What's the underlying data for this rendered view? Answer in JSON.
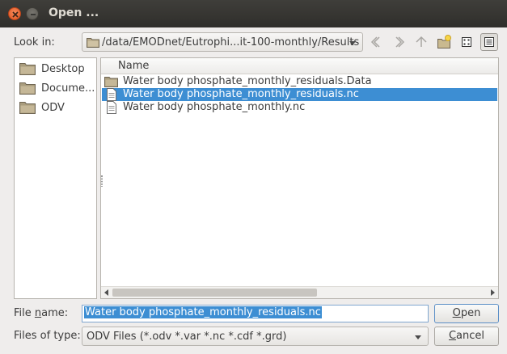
{
  "window": {
    "title": "Open ..."
  },
  "look_in": {
    "label": "Look in:",
    "path": "/data/EMODnet/Eutrophi...it-100-monthly/Results"
  },
  "toolbar": {
    "back_icon": "back-arrow-icon",
    "forward_icon": "forward-arrow-icon",
    "up_icon": "parent-directory-icon",
    "new_folder_icon": "new-folder-icon",
    "list_view_icon": "list-view-icon",
    "detail_view_icon": "detail-view-icon"
  },
  "sidebar": {
    "items": [
      {
        "label": "Desktop"
      },
      {
        "label": "Docume..."
      },
      {
        "label": "ODV"
      }
    ]
  },
  "file_list": {
    "column_name": "Name",
    "rows": [
      {
        "name": "Water body phosphate_monthly_residuals.Data",
        "type": "folder",
        "selected": false
      },
      {
        "name": "Water body phosphate_monthly_residuals.nc",
        "type": "file",
        "selected": true
      },
      {
        "name": "Water body phosphate_monthly.nc",
        "type": "file",
        "selected": false
      }
    ]
  },
  "file_name": {
    "label_prefix": "File ",
    "label_mnemonic": "n",
    "label_suffix": "ame:",
    "value": "Water body phosphate_monthly_residuals.nc"
  },
  "file_type": {
    "label": "Files of type:",
    "value": "ODV Files (*.odv *.var *.nc *.cdf *.grd)"
  },
  "buttons": {
    "open_mnemonic": "O",
    "open_rest": "pen",
    "cancel_mnemonic": "C",
    "cancel_rest": "ancel"
  },
  "colors": {
    "selection": "#3d8ed3",
    "titlebar": "#3f3e3a",
    "close_button": "#e95420"
  }
}
